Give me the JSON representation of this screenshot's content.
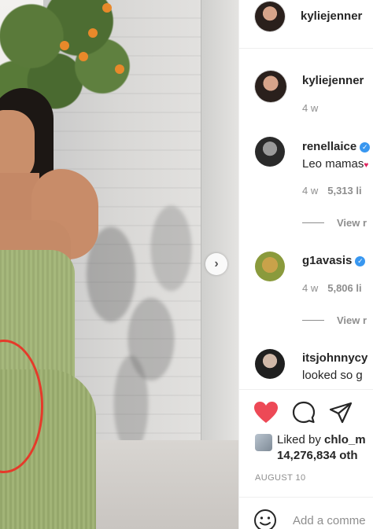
{
  "post": {
    "author": "kyliejenner"
  },
  "caption": {
    "author": "kyliejenner",
    "age": "4 w"
  },
  "comments": [
    {
      "author": "renellaice",
      "text": "Leo mamas",
      "age": "4 w",
      "likes": "5,313 li",
      "view_replies": "View r"
    },
    {
      "author": "g1avasis",
      "age": "4 w",
      "likes": "5,806 li",
      "view_replies": "View r"
    },
    {
      "author": "itsjohnnycy",
      "text": "looked so g"
    }
  ],
  "likes": {
    "liked_by_prefix": "Liked by ",
    "liked_by_user": "chlo_m",
    "count_text": "14,276,834 oth"
  },
  "date": "AUGUST 10",
  "comment_input": {
    "placeholder": "Add a comme"
  },
  "icons": {
    "like": "heart-icon",
    "comment": "comment-icon",
    "share": "paper-plane-icon",
    "emoji": "smiley-icon",
    "next": "chevron-right-icon",
    "verified": "verified-badge-icon"
  },
  "colors": {
    "like_active": "#ed4956",
    "verified": "#3897f0",
    "annotation": "#e53a2a"
  }
}
